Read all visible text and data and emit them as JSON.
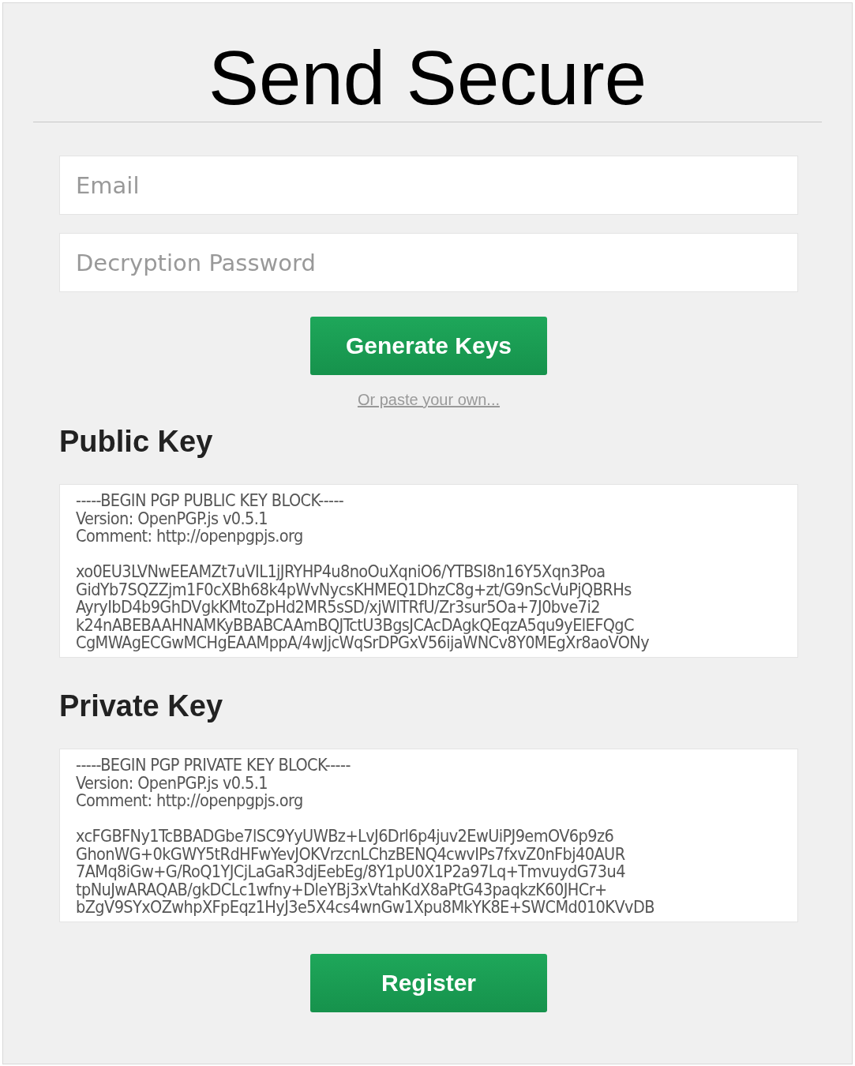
{
  "title": "Send Secure",
  "fields": [
    {
      "placeholder": "Email"
    },
    {
      "placeholder": "Decryption Password"
    }
  ],
  "generate_button": "Generate Keys",
  "paste_link": "Or paste your own...",
  "keys": [
    {
      "heading": "Public Key",
      "header": [
        "-----BEGIN PGP PUBLIC KEY BLOCK-----",
        "Version: OpenPGP.js v0.5.1",
        "Comment: http://openpgpjs.org"
      ],
      "body": [
        "xo0EU3LVNwEEAMZt7uVIL1jJRYHP4u8noOuXqniO6/YTBSI8n16Y5Xqn3Poa",
        "GidYb7SQZZjm1F0cXBh68k4pWvNycsKHMEQ1DhzC8g+zt/G9nScVuPjQBRHs",
        "AyryIbD4b9GhDVgkKMtoZpHd2MR5sSD/xjWlTRfU/Zr3sur5Oa+7J0bve7i2",
        "k24nABEBAAHNAMKyBBABCAAmBQJTctU3BgsJCAcDAgkQEqzA5qu9yElEFQgC",
        "CgMWAgECGwMCHgEAAMppA/4wJjcWqSrDPGxV56ijaWNCv8Y0MEgXr8aoVONy"
      ]
    },
    {
      "heading": "Private Key",
      "header": [
        "-----BEGIN PGP PRIVATE KEY BLOCK-----",
        "Version: OpenPGP.js v0.5.1",
        "Comment: http://openpgpjs.org"
      ],
      "body": [
        "xcFGBFNy1TcBBADGbe7lSC9YyUWBz+LvJ6Drl6p4juv2EwUiPJ9emOV6p9z6",
        "GhonWG+0kGWY5tRdHFwYevJOKVrzcnLChzBENQ4cwvIPs7fxvZ0nFbj40AUR",
        "7AMq8iGw+G/RoQ1YJCjLaGaR3djEebEg/8Y1pU0X1P2a97Lq+TmvuydG73u4",
        "tpNuJwARAQAB/gkDCLc1wfny+DleYBj3xVtahKdX8aPtG43paqkzK60JHCr+",
        "bZgV9SYxOZwhpXFpEqz1HyJ3e5X4cs4wnGw1Xpu8MkYK8E+SWCMd010KVvDB"
      ]
    }
  ],
  "register_button": "Register"
}
